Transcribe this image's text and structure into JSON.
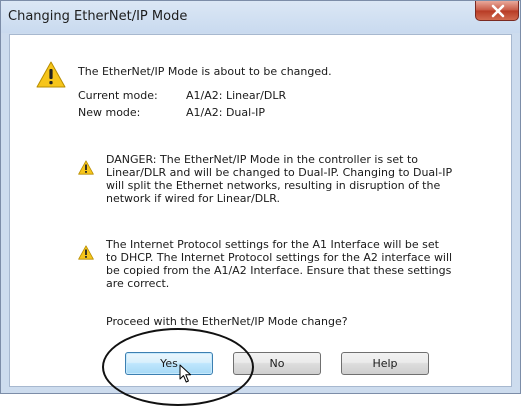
{
  "window": {
    "title": "Changing EtherNet/IP Mode"
  },
  "message": {
    "main": "The EtherNet/IP Mode is about to be changed.",
    "current_mode_label": "Current mode:",
    "current_mode_value": "A1/A2: Linear/DLR",
    "new_mode_label": "New mode:",
    "new_mode_value": "A1/A2: Dual-IP",
    "danger_text": "DANGER: The EtherNet/IP Mode in the controller is set to\nLinear/DLR and will be changed to Dual-IP. Changing to Dual-IP\nwill split the Ethernet networks, resulting in disruption of the\nnetwork if wired for Linear/DLR.",
    "protocol_text": "The Internet Protocol settings for the A1 Interface will be set\nto DHCP. The Internet Protocol settings for the A2 interface will\nbe copied from the A1/A2 Interface. Ensure that these settings\nare correct.",
    "question": "Proceed with the EtherNet/IP Mode change?"
  },
  "buttons": {
    "yes": "Yes",
    "no": "No",
    "help": "Help"
  },
  "icons": {
    "title_close": "close-icon",
    "main_warning": "warning-icon",
    "danger_warning": "warning-icon",
    "protocol_warning": "warning-icon",
    "pointer": "mouse-pointer-icon"
  },
  "colors": {
    "warning_yellow": "#f6c51b",
    "close_red": "#c75843",
    "default_button_blue": "#bee6fd"
  }
}
